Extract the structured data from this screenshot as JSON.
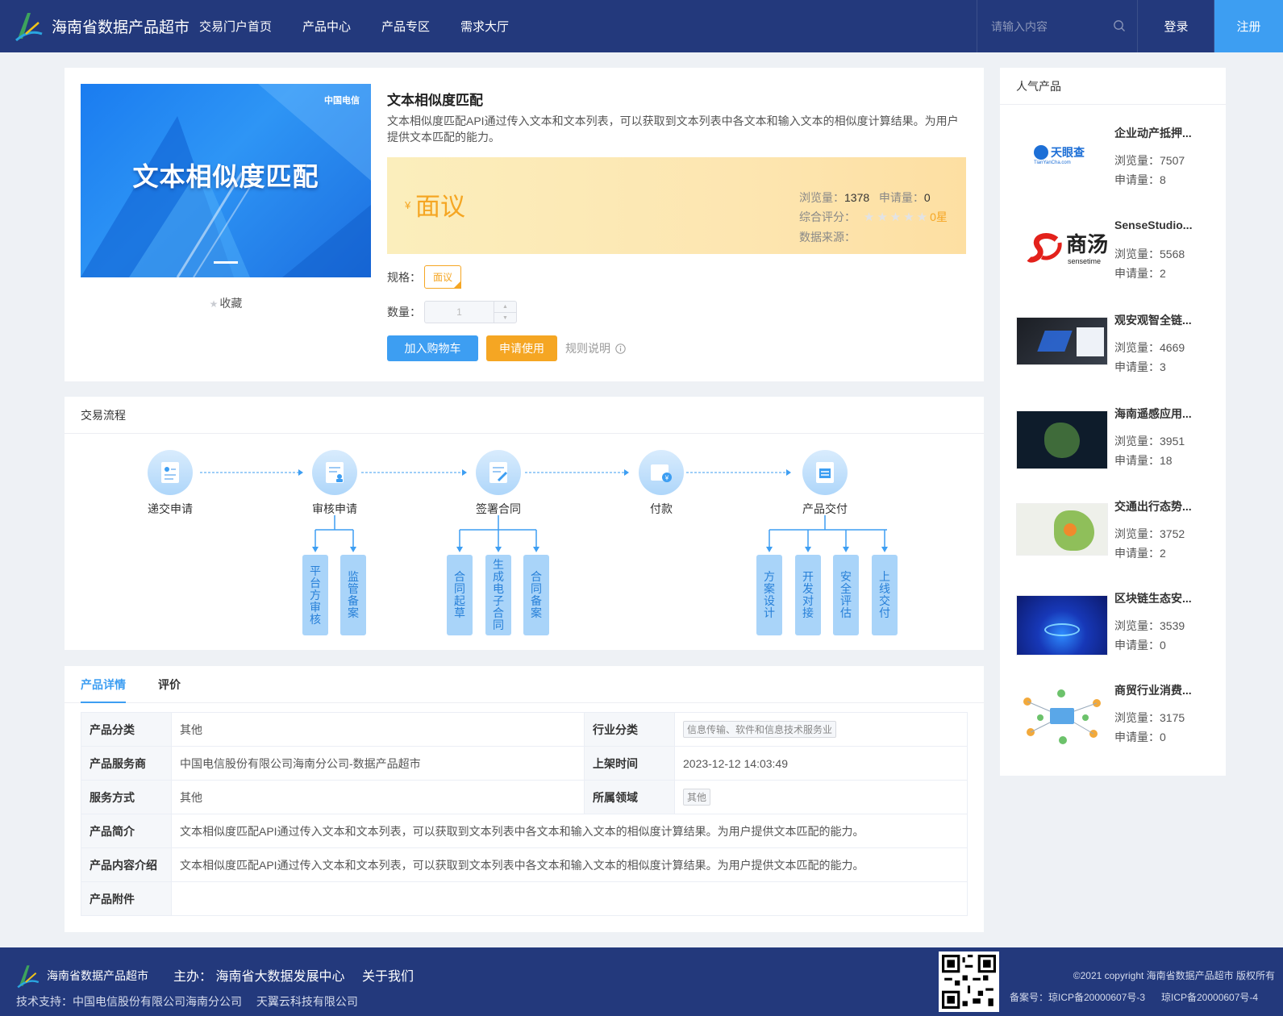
{
  "header": {
    "brand": "海南省数据产品超市",
    "nav": [
      "交易门户首页",
      "产品中心",
      "产品专区",
      "需求大厅"
    ],
    "search_placeholder": "请输入内容",
    "login": "登录",
    "register": "注册"
  },
  "product": {
    "banner_title": "文本相似度匹配",
    "banner_logo": "中国电信",
    "favorite": "收藏",
    "title": "文本相似度匹配",
    "description": "文本相似度匹配API通过传入文本和文本列表，可以获取到文本列表中各文本和输入文本的相似度计算结果。为用户提供文本匹配的能力。",
    "price_symbol": "¥",
    "price": "面议",
    "views_label": "浏览量：",
    "views": "1378",
    "applies_label": "申请量：",
    "applies": "0",
    "rating_label": "综合评分：",
    "rating": "0星",
    "rating_value": 0,
    "source_label": "数据来源：",
    "spec_label": "规格：",
    "spec_value": "面议",
    "qty_label": "数量：",
    "qty_value": "1",
    "add_cart": "加入购物车",
    "apply": "申请使用",
    "rules": "规则说明"
  },
  "process": {
    "title": "交易流程",
    "steps": [
      "递交申请",
      "审核申请",
      "签署合同",
      "付款",
      "产品交付"
    ],
    "sub_steps": [
      "平台方审核",
      "监管备案",
      "合同起草",
      "生成电子合同",
      "合同备案",
      "方案设计",
      "开发对接",
      "安全评估",
      "上线交付"
    ]
  },
  "detail": {
    "tabs": [
      "产品详情",
      "评价"
    ],
    "rows": {
      "category_label": "产品分类",
      "category": "其他",
      "industry_label": "行业分类",
      "industry": "信息传输、软件和信息技术服务业",
      "provider_label": "产品服务商",
      "provider": "中国电信股份有限公司海南分公司-数据产品超市",
      "online_label": "上架时间",
      "online": "2023-12-12 14:03:49",
      "service_label": "服务方式",
      "service": "其他",
      "field_label": "所属领域",
      "field": "其他",
      "intro_label": "产品简介",
      "intro": "文本相似度匹配API通过传入文本和文本列表，可以获取到文本列表中各文本和输入文本的相似度计算结果。为用户提供文本匹配的能力。",
      "content_label": "产品内容介绍",
      "content": "文本相似度匹配API通过传入文本和文本列表，可以获取到文本列表中各文本和输入文本的相似度计算结果。为用户提供文本匹配的能力。",
      "attach_label": "产品附件"
    }
  },
  "popular": {
    "title": "人气产品",
    "views_label": "浏览量：",
    "applies_label": "申请量：",
    "items": [
      {
        "name": "企业动产抵押...",
        "views": "7507",
        "applies": "8",
        "logo": "天眼查",
        "logo_sub": "TianYanCha.com"
      },
      {
        "name": "SenseStudio...",
        "views": "5568",
        "applies": "2",
        "logo": "商汤",
        "logo_sub": "sensetime"
      },
      {
        "name": "观安观智全链...",
        "views": "4669",
        "applies": "3"
      },
      {
        "name": "海南遥感应用...",
        "views": "3951",
        "applies": "18"
      },
      {
        "name": "交通出行态势...",
        "views": "3752",
        "applies": "2"
      },
      {
        "name": "区块链生态安...",
        "views": "3539",
        "applies": "0"
      },
      {
        "name": "商贸行业消费...",
        "views": "3175",
        "applies": "0"
      }
    ]
  },
  "footer": {
    "brand": "海南省数据产品超市",
    "host": "主办： 海南省大数据发展中心",
    "about": "关于我们",
    "support": "技术支持：中国电信股份有限公司海南分公司　 天翼云科技有限公司",
    "copyright": "©2021 copyright 海南省数据产品超市 版权所有",
    "icp1": "备案号：琼ICP备20000607号-3",
    "icp2": "琼ICP备20000607号-4"
  },
  "colors": {
    "header_bg": "#23397c",
    "primary": "#3d9ef2",
    "accent": "#f5a623"
  }
}
